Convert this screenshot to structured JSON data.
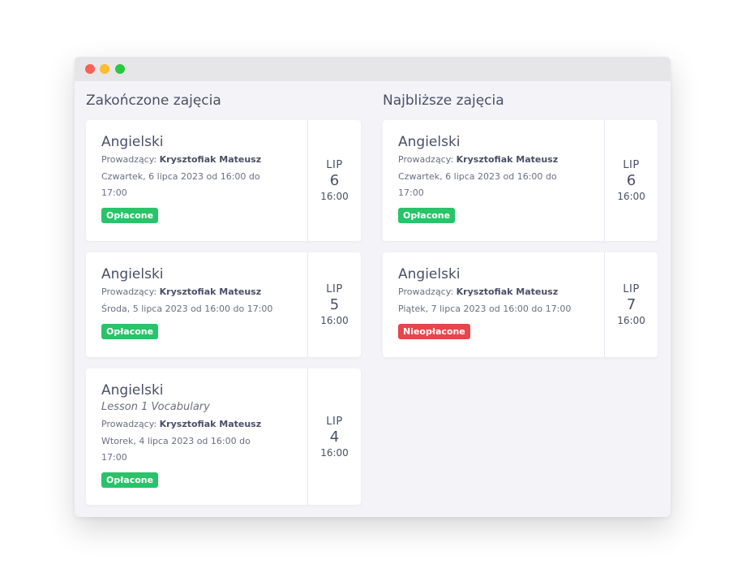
{
  "window": {
    "controls": [
      "close",
      "minimize",
      "maximize"
    ]
  },
  "colors": {
    "paid": "#29c36a",
    "unpaid": "#e8454c",
    "text": "#4a4f68",
    "background": "#f4f4f8"
  },
  "finished": {
    "title": "Zakończone zajęcia",
    "cards": [
      {
        "subject": "Angielski",
        "teacher_label": "Prowadzący:",
        "teacher": "Krysztofiak Mateusz",
        "when": "Czwartek, 6 lipca 2023 od 16:00 do 17:00",
        "status": "Opłacone",
        "month": "LIP",
        "day": "6",
        "time": "16:00"
      },
      {
        "subject": "Angielski",
        "teacher_label": "Prowadzący:",
        "teacher": "Krysztofiak Mateusz",
        "when": "Środa, 5 lipca 2023 od 16:00 do 17:00",
        "status": "Opłacone",
        "month": "LIP",
        "day": "5",
        "time": "16:00"
      },
      {
        "subject": "Angielski",
        "lesson": "Lesson 1 Vocabulary",
        "teacher_label": "Prowadzący:",
        "teacher": "Krysztofiak Mateusz",
        "when": "Wtorek, 4 lipca 2023 od 16:00 do 17:00",
        "status": "Opłacone",
        "month": "LIP",
        "day": "4",
        "time": "16:00"
      }
    ]
  },
  "upcoming": {
    "title": "Najbliższe zajęcia",
    "cards": [
      {
        "subject": "Angielski",
        "teacher_label": "Prowadzący:",
        "teacher": "Krysztofiak Mateusz",
        "when": "Czwartek, 6 lipca 2023 od 16:00 do 17:00",
        "status": "Opłacone",
        "month": "LIP",
        "day": "6",
        "time": "16:00"
      },
      {
        "subject": "Angielski",
        "teacher_label": "Prowadzący:",
        "teacher": "Krysztofiak Mateusz",
        "when": "Piątek, 7 lipca 2023 od 16:00 do 17:00",
        "status": "Nieopłacone",
        "month": "LIP",
        "day": "7",
        "time": "16:00"
      }
    ]
  }
}
